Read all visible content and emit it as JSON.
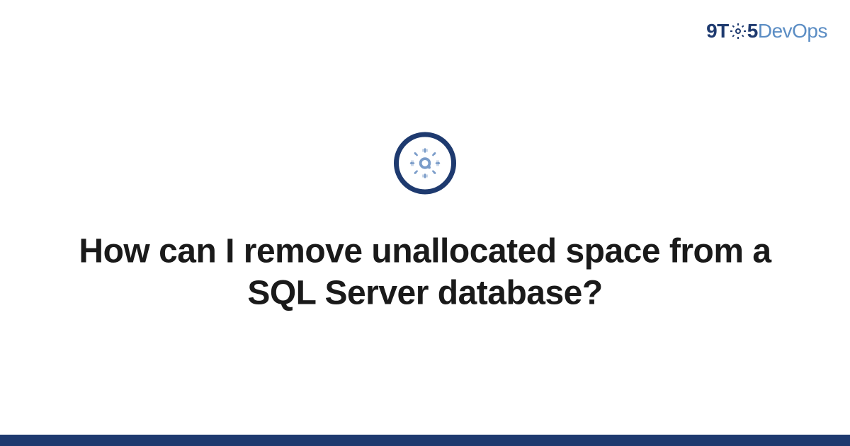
{
  "logo": {
    "prefix": "9T",
    "middle": "5",
    "suffix": "DevOps"
  },
  "icon": {
    "name": "gear-icon"
  },
  "title": "How can I remove unallocated space from a SQL Server database?",
  "colors": {
    "primary": "#1e3a6f",
    "accent": "#5b8dc4",
    "text": "#1a1a1a"
  }
}
